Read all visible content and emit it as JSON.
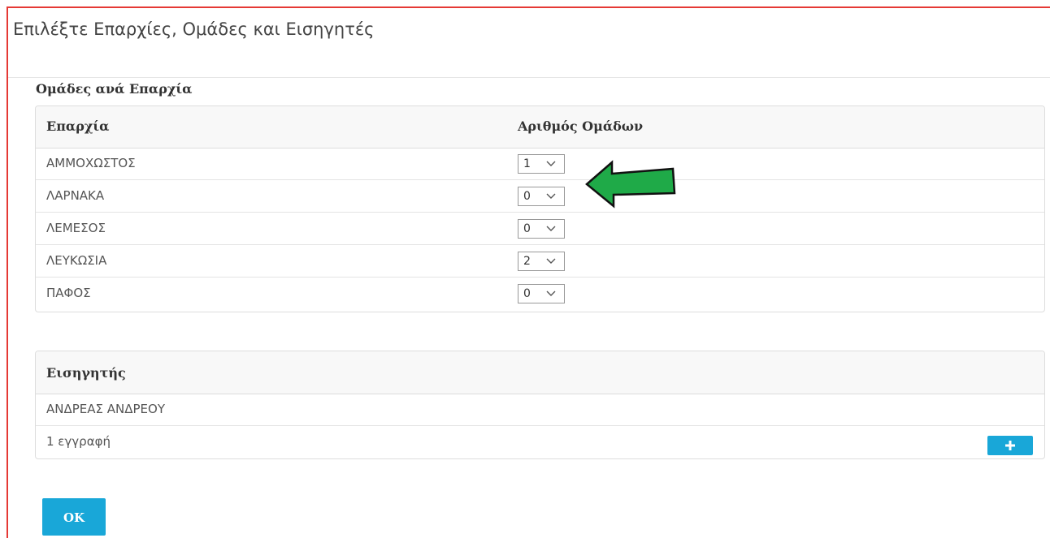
{
  "dialog": {
    "title": "Επιλέξτε Επαρχίες, Ομάδες και Εισηγητές"
  },
  "regions": {
    "section_title": "Ομάδες ανά Επαρχία",
    "columns": [
      "Επαρχία",
      "Αριθμός Ομάδων"
    ],
    "rows": [
      {
        "name": "ΑΜΜΟΧΩΣΤΟΣ",
        "groups": "1"
      },
      {
        "name": "ΛΑΡΝΑΚΑ",
        "groups": "0"
      },
      {
        "name": "ΛΕΜΕΣΟΣ",
        "groups": "0"
      },
      {
        "name": "ΛΕΥΚΩΣΙΑ",
        "groups": "2"
      },
      {
        "name": "ΠΑΦΟΣ",
        "groups": "0"
      }
    ]
  },
  "rapporteurs": {
    "column": "Εισηγητής",
    "rows": [
      "ΑΝΔΡΕΑΣ ΑΝΔΡΕΟΥ"
    ],
    "count_text": "1 εγγραφή"
  },
  "buttons": {
    "ok_label": "OK"
  },
  "colors": {
    "accent": "#19a7d8",
    "frame_border": "#e53935",
    "arrow": "#1faa48"
  }
}
